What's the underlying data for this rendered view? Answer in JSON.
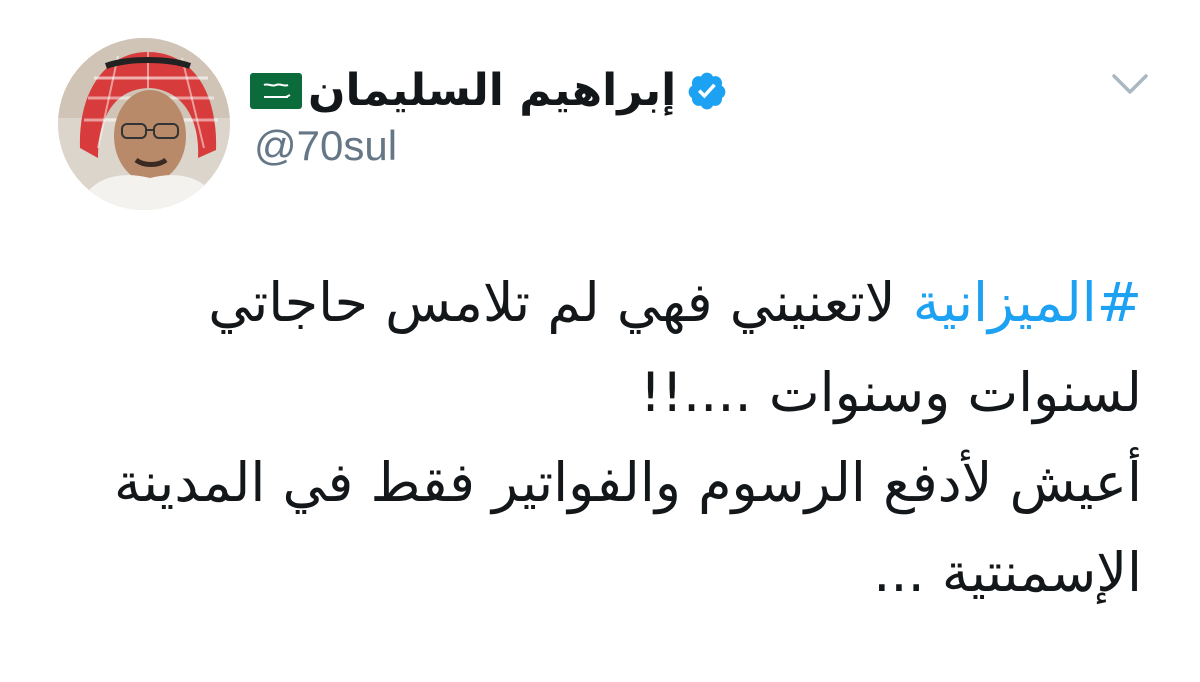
{
  "user": {
    "display_name": "إبراهيم السليمان",
    "handle": "@70sul",
    "verified": true,
    "flag": "saudi-arabia-flag",
    "avatar": "profile-photo-avatar"
  },
  "tweet": {
    "hashtag": "#الميزانية",
    "line1_rest": " لاتعنيني فهي لم تلامس حاجاتي",
    "line2": "لسنوات وسنوات ....!!",
    "line3": "أعيش لأدفع الرسوم والفواتير فقط في المدينة",
    "line4": "الإسمنتية ..."
  },
  "menu": {
    "icon": "chevron-down-icon"
  },
  "colors": {
    "hashtag": "#1da1f2",
    "verified_badge": "#1da1f2",
    "text": "#14171a",
    "handle": "#657786",
    "caret": "#aab8c2",
    "flag_green": "#0c6b3a"
  }
}
